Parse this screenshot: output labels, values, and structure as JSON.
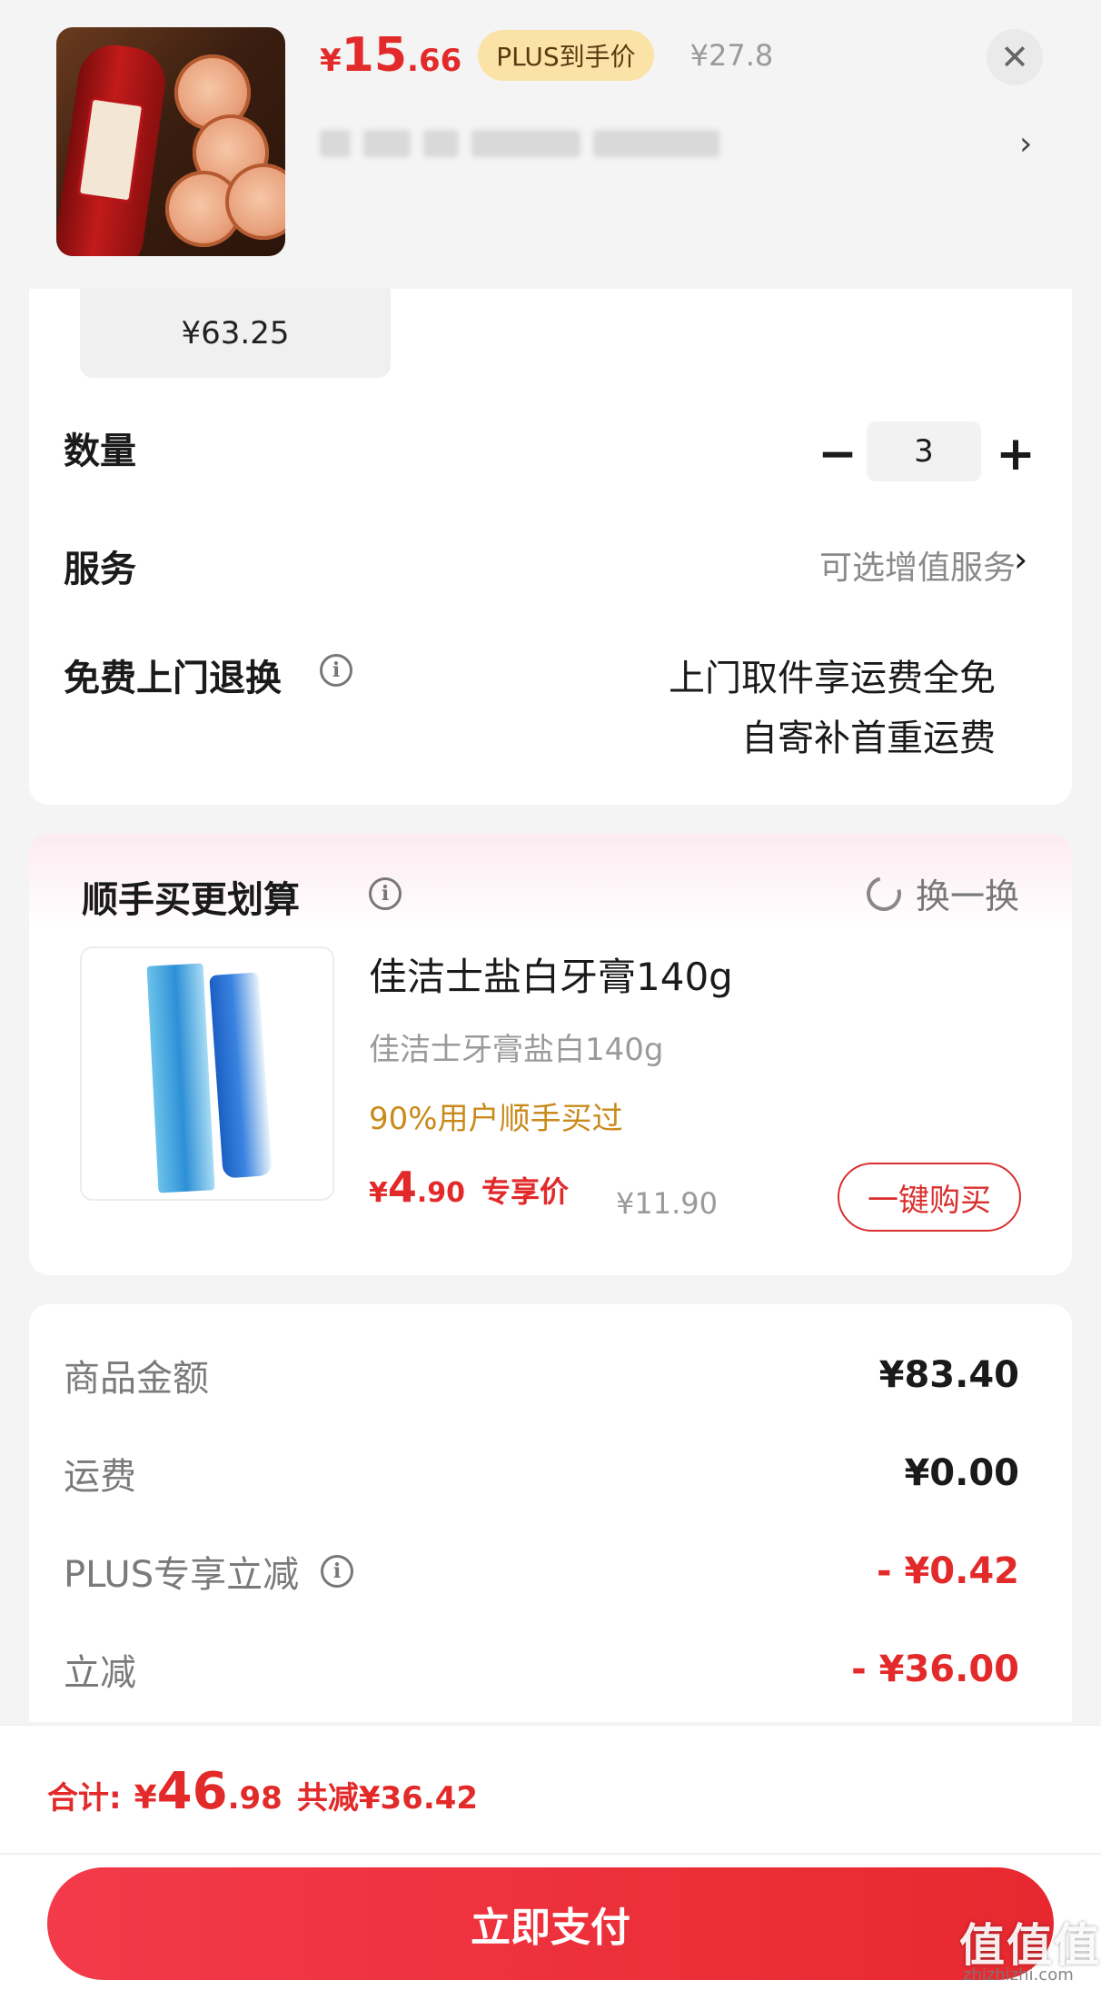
{
  "header": {
    "price": {
      "yen": "¥",
      "int": "15",
      "dec": ".66"
    },
    "plus_badge": "PLUS到手价",
    "original_price": "¥27.8",
    "close_glyph": "✕",
    "chevron_glyph": "›"
  },
  "spec": {
    "chip_price": "¥63.25"
  },
  "quantity": {
    "label": "数量",
    "minus": "−",
    "value": "3",
    "plus": "+"
  },
  "service": {
    "label": "服务",
    "value": "可选增值服务",
    "chevron": "›"
  },
  "free_return": {
    "label": "免费上门退换",
    "info_glyph": "i",
    "line1": "上门取件享运费全免",
    "line2": "自寄补首重运费"
  },
  "upsell": {
    "title": "顺手买更划算",
    "info_glyph": "i",
    "swap_label": "换一换",
    "product": {
      "name": "佳洁士盐白牙膏140g",
      "subtitle": "佳洁士牙膏盐白140g",
      "users": "90%用户顺手买过",
      "price": {
        "yen": "¥",
        "int": "4",
        "dec": ".90"
      },
      "price_tag": "专享价",
      "original_price": "¥11.90",
      "buy_label": "一键购买"
    }
  },
  "summary": {
    "rows": [
      {
        "label": "商品金额",
        "value": "¥83.40"
      },
      {
        "label": "运费",
        "value": "¥0.00"
      },
      {
        "label": "PLUS专享立减",
        "value": "- ¥0.42"
      },
      {
        "label": "立减",
        "value": "- ¥36.00"
      }
    ]
  },
  "footer": {
    "total_label": "合计:",
    "total": {
      "yen": "¥",
      "int": "46",
      "dec": ".98"
    },
    "saved": "共减¥36.42",
    "pay_label": "立即支付"
  },
  "watermark": {
    "main": "值值值",
    "sub": "zhizhizhi.com"
  },
  "colors": {
    "accent_red": "#e32a2a",
    "plus_gold": "#fbe3a7",
    "users_orange": "#c98a1b"
  }
}
